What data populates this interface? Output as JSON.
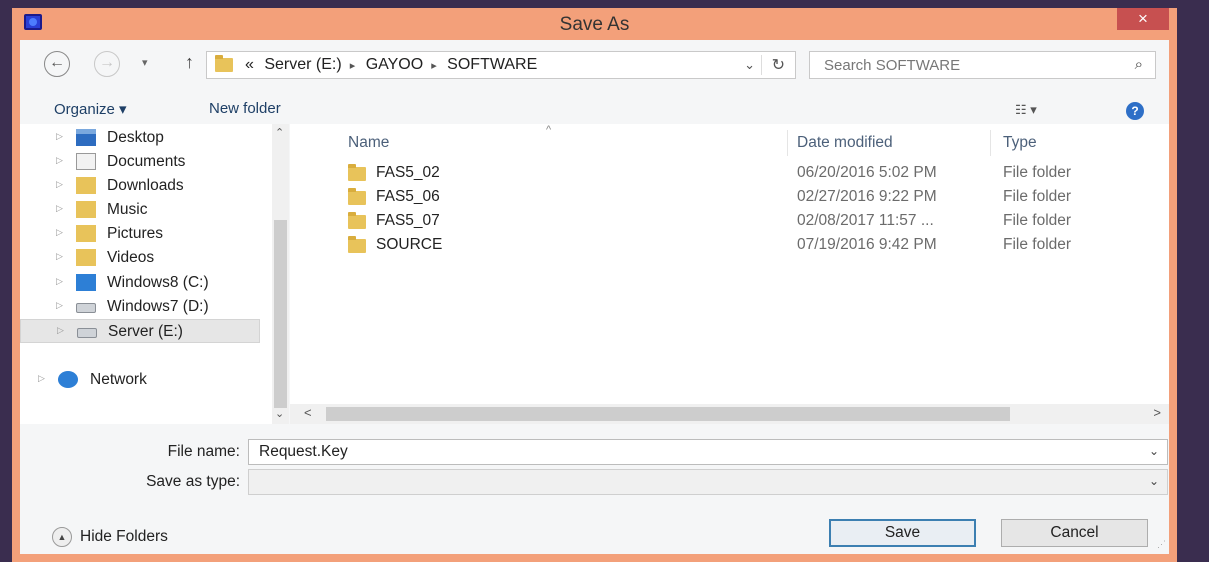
{
  "window": {
    "title": "Save As",
    "close_glyph": "×"
  },
  "nav": {
    "back_glyph": "←",
    "forward_glyph": "→",
    "recent_glyph": "▾",
    "up_glyph": "↑",
    "address": {
      "prefix": "«",
      "crumbs": [
        "Server (E:)",
        "GAYOO",
        "SOFTWARE"
      ],
      "separator": "▸",
      "dropdown_glyph": "⌄",
      "refresh_glyph": "↻"
    },
    "search": {
      "placeholder": "Search SOFTWARE",
      "icon_glyph": "⌕"
    }
  },
  "toolbar": {
    "organize_label": "Organize ▾",
    "new_folder_label": "New folder",
    "view_glyph": "☷ ▾",
    "help_glyph": "?"
  },
  "navpane": {
    "items": [
      {
        "label": "Desktop",
        "icon": "desktop-icon"
      },
      {
        "label": "Documents",
        "icon": "documents-icon"
      },
      {
        "label": "Downloads",
        "icon": "downloads-icon"
      },
      {
        "label": "Music",
        "icon": "music-icon"
      },
      {
        "label": "Pictures",
        "icon": "pictures-icon"
      },
      {
        "label": "Videos",
        "icon": "videos-icon"
      },
      {
        "label": "Windows8 (C:)",
        "icon": "drive-c-icon"
      },
      {
        "label": "Windows7 (D:)",
        "icon": "drive-d-icon"
      },
      {
        "label": "Server (E:)",
        "icon": "drive-e-icon",
        "selected": true
      },
      {
        "label": "Network",
        "icon": "network-icon"
      }
    ],
    "expand_glyph": "▷",
    "scroll_up_glyph": "⌃",
    "scroll_down_glyph": "⌄"
  },
  "filelist": {
    "columns": [
      "Name",
      "Date modified",
      "Type"
    ],
    "sort_glyph": "^",
    "rows": [
      {
        "name": "FAS5_02",
        "date": "06/20/2016 5:02 PM",
        "type": "File folder"
      },
      {
        "name": "FAS5_06",
        "date": "02/27/2016 9:22 PM",
        "type": "File folder"
      },
      {
        "name": "FAS5_07",
        "date": "02/08/2017 11:57 ...",
        "type": "File folder"
      },
      {
        "name": "SOURCE",
        "date": "07/19/2016 9:42 PM",
        "type": "File folder"
      }
    ],
    "hscroll_left_glyph": "<",
    "hscroll_right_glyph": ">"
  },
  "form": {
    "filename_label": "File name:",
    "filename_value": "Request.Key",
    "savetype_label": "Save as type:",
    "savetype_value": "",
    "dropdown_glyph": "⌄"
  },
  "footer": {
    "hide_folders_label": "Hide Folders",
    "hide_folders_glyph": "▲",
    "save_label": "Save",
    "cancel_label": "Cancel",
    "grip_glyph": "⋰"
  },
  "colors": {
    "window_frame": "#f3a07a",
    "desktop_bg": "#3a2d4f",
    "close_button": "#c75050",
    "link_text": "#1e3f66"
  }
}
